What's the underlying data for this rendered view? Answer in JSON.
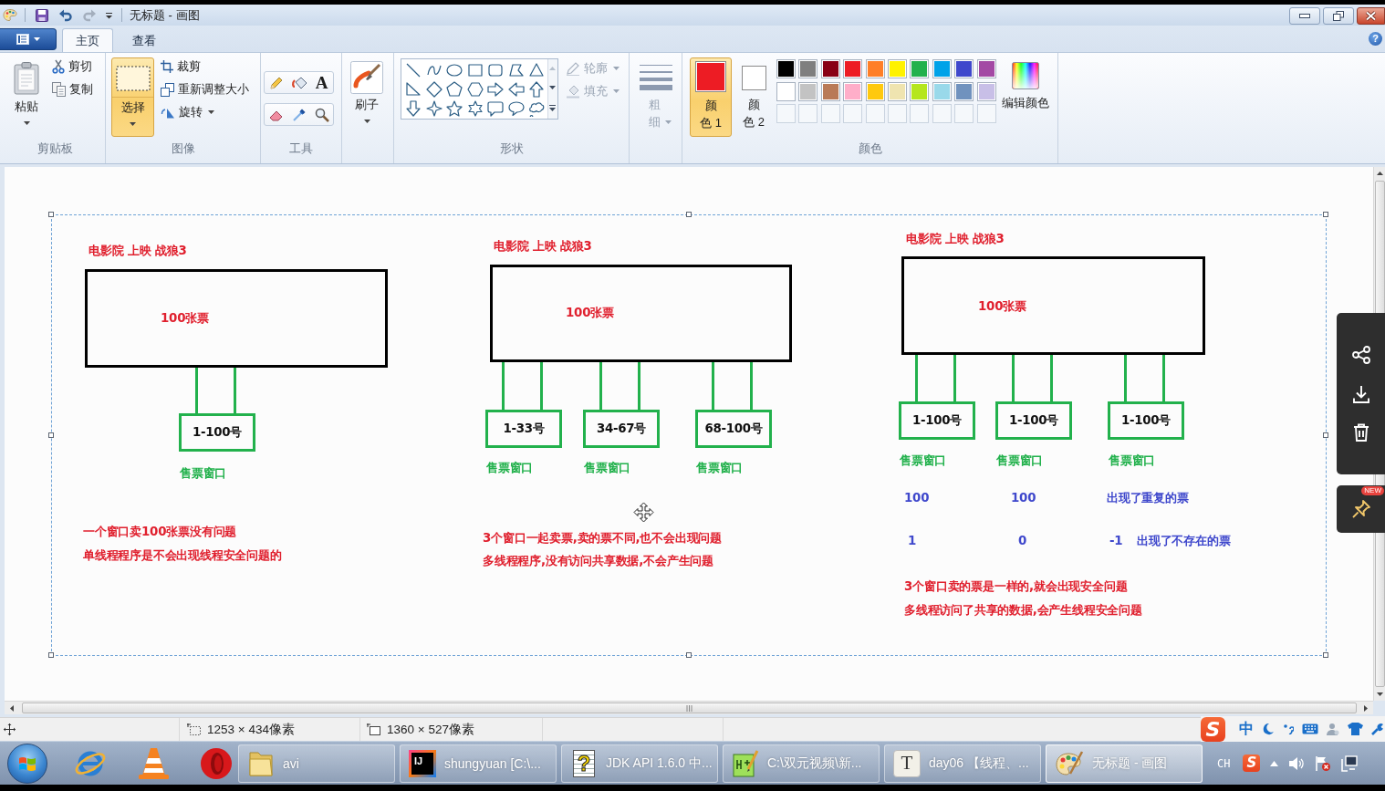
{
  "window": {
    "title": "无标题 - 画图",
    "quick_access": [
      {
        "kind": "save",
        "disabled": false
      },
      {
        "kind": "undo",
        "disabled": false
      },
      {
        "kind": "redo",
        "disabled": true
      }
    ]
  },
  "ribbon": {
    "tabs": [
      {
        "label": "主页",
        "selected": true
      },
      {
        "label": "查看",
        "selected": false
      }
    ],
    "help": "?",
    "clipboard": {
      "label": "剪贴板",
      "paste": "粘贴",
      "cut": "剪切",
      "copy": "复制"
    },
    "image": {
      "label": "图像",
      "select": {
        "label": "选择",
        "selected": true
      },
      "crop": "裁剪",
      "resize": "重新调整大小",
      "rotate": "旋转"
    },
    "tools": {
      "label": "工具",
      "text_tool": "A"
    },
    "brushes": {
      "label": "刷子"
    },
    "shapes": {
      "label": "形状",
      "outline": {
        "label": "轮廓",
        "disabled": true
      },
      "fill": {
        "label": "填充",
        "disabled": true
      }
    },
    "size": {
      "label": "粗细",
      "disabled": true
    },
    "colors": {
      "label": "颜色",
      "color1": {
        "label": "颜色 1",
        "color": "#ed1c24",
        "selected": true
      },
      "color2": {
        "label": "颜色 2",
        "color": "#ffffff",
        "selected": false
      },
      "palette": [
        {
          "color": "#000000"
        },
        {
          "color": "#7f7f7f"
        },
        {
          "color": "#880015"
        },
        {
          "color": "#ed1c24"
        },
        {
          "color": "#ff7f27"
        },
        {
          "color": "#fff200"
        },
        {
          "color": "#22b14c"
        },
        {
          "color": "#00a2e8"
        },
        {
          "color": "#3f48cc"
        },
        {
          "color": "#a349a4"
        },
        {
          "color": "#ffffff"
        },
        {
          "color": "#c3c3c3"
        },
        {
          "color": "#b97a57"
        },
        {
          "color": "#ffaec9"
        },
        {
          "color": "#ffc90e"
        },
        {
          "color": "#efe4b0"
        },
        {
          "color": "#b5e61d"
        },
        {
          "color": "#99d9ea"
        },
        {
          "color": "#7092be"
        },
        {
          "color": "#c8bfe7"
        }
      ],
      "edit": "编辑颜色"
    }
  },
  "canvas": {
    "diagrams": [
      {
        "title": "电影院 上映 战狼3",
        "store": "100张票",
        "windows": [
          {
            "range": "1-100号",
            "label": "售票窗口"
          }
        ],
        "notes": [
          "一个窗口卖100张票没有问题",
          "单线程程序是不会出现线程安全问题的"
        ]
      },
      {
        "title": "电影院 上映 战狼3",
        "store": "100张票",
        "windows": [
          {
            "range": "1-33号",
            "label": "售票窗口"
          },
          {
            "range": "34-67号",
            "label": "售票窗口"
          },
          {
            "range": "68-100号",
            "label": "售票窗口"
          }
        ],
        "notes": [
          "3个窗口一起卖票,卖的票不同,也不会出现问题",
          "多线程程序,没有访问共享数据,不会产生问题"
        ]
      },
      {
        "title": "电影院 上映 战狼3",
        "store": "100张票",
        "windows": [
          {
            "range": "1-100号",
            "label": "售票窗口"
          },
          {
            "range": "1-100号",
            "label": "售票窗口"
          },
          {
            "range": "1-100号",
            "label": "售票窗口"
          }
        ],
        "results": [
          {
            "cells": [
              "100",
              "100",
              "出现了重复的票"
            ]
          },
          {
            "cells": [
              "1",
              "0",
              "-1",
              "出现了不存在的票"
            ]
          }
        ],
        "notes": [
          "3个窗口卖的票是一样的,就会出现安全问题",
          "多线程访问了共享的数据,会产生线程安全问题"
        ]
      }
    ]
  },
  "floating_toolbar": {
    "badge": "NEW"
  },
  "status_bar": {
    "selection_size": "1253 × 434像素",
    "canvas_size": "1360 × 527像素"
  },
  "ime_bar": {
    "logo": "S",
    "mode": "中"
  },
  "taskbar": {
    "windows": [
      {
        "label": "avi",
        "kind": "folder",
        "selected": false
      },
      {
        "label": "shungyuan [C:\\...",
        "kind": "ide",
        "logo": "IJ",
        "selected": false
      },
      {
        "label": "JDK API 1.6.0 中...",
        "kind": "help",
        "logo": "?",
        "selected": false
      },
      {
        "label": "C:\\双元视频\\新...",
        "kind": "editor",
        "selected": false
      },
      {
        "label": "day06 【线程、...",
        "kind": "document",
        "logo": "T",
        "selected": false
      },
      {
        "label": "无标题 - 画图",
        "kind": "paint",
        "selected": true
      }
    ],
    "tray": {
      "language": "CH",
      "ime_logo": "S"
    }
  }
}
